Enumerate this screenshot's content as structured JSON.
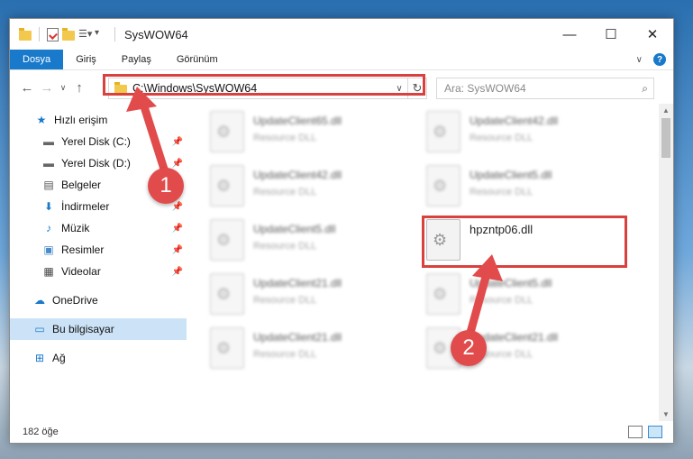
{
  "window": {
    "title": "SysWOW64",
    "minimize": "—",
    "maximize": "☐",
    "close": "✕"
  },
  "ribbon": {
    "tabs": [
      "Dosya",
      "Giriş",
      "Paylaş",
      "Görünüm"
    ]
  },
  "address": {
    "path": "C:\\Windows\\SysWOW64",
    "search_placeholder": "Ara: SysWOW64"
  },
  "sidebar": {
    "items": [
      {
        "label": "Hızlı erişim",
        "icon": "star-icon"
      },
      {
        "label": "Yerel Disk (C:)",
        "icon": "drive-icon"
      },
      {
        "label": "Yerel Disk (D:)",
        "icon": "drive-icon"
      },
      {
        "label": "Belgeler",
        "icon": "document-icon"
      },
      {
        "label": "İndirmeler",
        "icon": "download-icon"
      },
      {
        "label": "Müzik",
        "icon": "music-icon"
      },
      {
        "label": "Resimler",
        "icon": "pictures-icon"
      },
      {
        "label": "Videolar",
        "icon": "video-icon"
      },
      {
        "label": "OneDrive",
        "icon": "cloud-icon"
      },
      {
        "label": "Bu bilgisayar",
        "icon": "computer-icon"
      },
      {
        "label": "Ağ",
        "icon": "network-icon"
      }
    ]
  },
  "files": [
    {
      "name": "UpdateClient65.dll",
      "desc": "Resource DLL"
    },
    {
      "name": "UpdateClient42.dll",
      "desc": "Resource DLL"
    },
    {
      "name": "UpdateClient42.dll",
      "desc": "Resource DLL"
    },
    {
      "name": "UpdateClient5.dll",
      "desc": "Resource DLL"
    },
    {
      "name": "UpdateClient5.dll",
      "desc": "Resource DLL"
    },
    {
      "name": "hpzntp06.dll",
      "desc": ""
    },
    {
      "name": "UpdateClient21.dll",
      "desc": "Resource DLL"
    },
    {
      "name": "UpdateClient5.dll",
      "desc": "Resource DLL"
    },
    {
      "name": "UpdateClient21.dll",
      "desc": "Resource DLL"
    },
    {
      "name": "UpdateClient21.dll",
      "desc": "Resource DLL"
    }
  ],
  "status": {
    "count": "182 öğe"
  },
  "annotations": {
    "step1": "1",
    "step2": "2",
    "highlight_color": "#d9413f"
  }
}
